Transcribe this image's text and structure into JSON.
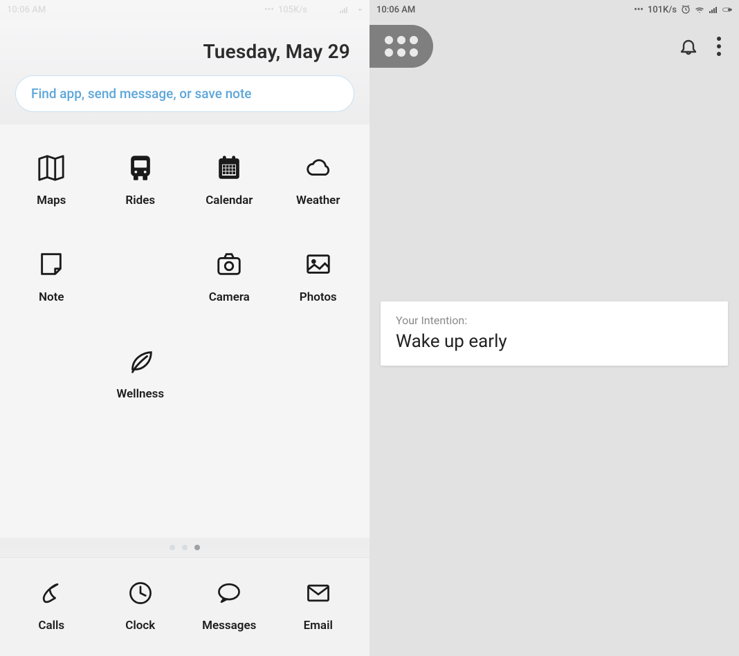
{
  "left": {
    "status": {
      "time": "10:06 AM",
      "speed": "105K/s"
    },
    "date": "Tuesday, May 29",
    "search": {
      "placeholder": "Find app, send message, or save note"
    },
    "grid": [
      [
        {
          "icon": "map",
          "label": "Maps"
        },
        {
          "icon": "bus",
          "label": "Rides"
        },
        {
          "icon": "calendar",
          "label": "Calendar"
        },
        {
          "icon": "cloud",
          "label": "Weather"
        }
      ],
      [
        {
          "icon": "note",
          "label": "Note"
        },
        null,
        {
          "icon": "camera",
          "label": "Camera"
        },
        {
          "icon": "photo",
          "label": "Photos"
        }
      ],
      [
        null,
        {
          "icon": "leaf",
          "label": "Wellness"
        },
        null,
        null
      ]
    ],
    "dots": {
      "count": 3,
      "active": 2
    },
    "dock": [
      {
        "icon": "phone",
        "label": "Calls"
      },
      {
        "icon": "clock",
        "label": "Clock"
      },
      {
        "icon": "chat",
        "label": "Messages"
      },
      {
        "icon": "mail",
        "label": "Email"
      }
    ]
  },
  "right": {
    "status": {
      "time": "10:06 AM",
      "speed": "101K/s"
    },
    "intention": {
      "title": "Your Intention:",
      "text": "Wake up early"
    }
  }
}
